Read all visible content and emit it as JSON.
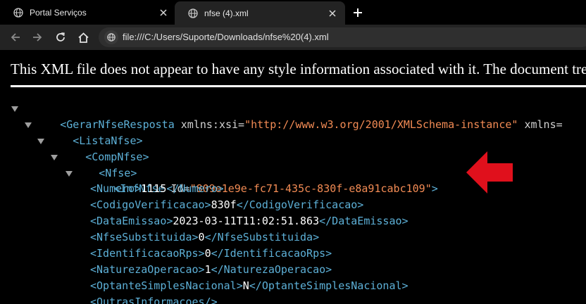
{
  "tabs": [
    {
      "title": "Portal Serviços",
      "active": false
    },
    {
      "title": "nfse (4).xml",
      "active": true
    }
  ],
  "address": {
    "url": "file:///C:/Users/Suporte/Downloads/nfse%20(4).xml"
  },
  "page": {
    "banner": "This XML file does not appear to have any style information associated with it. The document tree is shown below."
  },
  "xml": {
    "root_open": "<GerarNfseResposta",
    "root_attr": " xmlns:xsi=",
    "root_value": "\"http://www.w3.org/2001/XMLSchema-instance\"",
    "root_attr2": " xmlns=",
    "lista_open": "<ListaNfse>",
    "comp_open": "<CompNfse>",
    "nfse_open": "<Nfse>",
    "inf_open": "<InfNfse",
    "inf_attr": " Id=",
    "inf_value": "\"809e1e9e-fc71-435c-830f-e8a91cabc109\"",
    "inf_close": ">",
    "elements": [
      {
        "open": "<Numero>",
        "value": "1115",
        "close": "</Numero>"
      },
      {
        "open": "<CodigoVerificacao>",
        "value": "830f",
        "close": "</CodigoVerificacao>"
      },
      {
        "open": "<DataEmissao>",
        "value": "2023-03-11T11:02:51.863",
        "close": "</DataEmissao>"
      },
      {
        "open": "<NfseSubstituida>",
        "value": "0",
        "close": "</NfseSubstituida>"
      },
      {
        "open": "<IdentificacaoRps>",
        "value": "0",
        "close": "</IdentificacaoRps>"
      },
      {
        "open": "<NaturezaOperacao>",
        "value": "1",
        "close": "</NaturezaOperacao>"
      },
      {
        "open": "<OptanteSimplesNacional>",
        "value": "N",
        "close": "</OptanteSimplesNacional>"
      },
      {
        "open": "<OutrasInformacoes/>",
        "value": "",
        "close": ""
      }
    ]
  },
  "colors": {
    "tag": "#5db0d7",
    "attribute_value": "#f28b54",
    "annotation_arrow": "#e0101c"
  },
  "icons": {
    "tab1": "globe-icon",
    "tab2": "globe-icon",
    "close": "close-icon",
    "new_tab": "plus-icon",
    "back": "back-arrow-icon",
    "forward": "forward-arrow-icon",
    "reload": "reload-icon",
    "home": "home-icon",
    "site_info": "globe-icon",
    "annotation": "red-arrow-icon"
  }
}
